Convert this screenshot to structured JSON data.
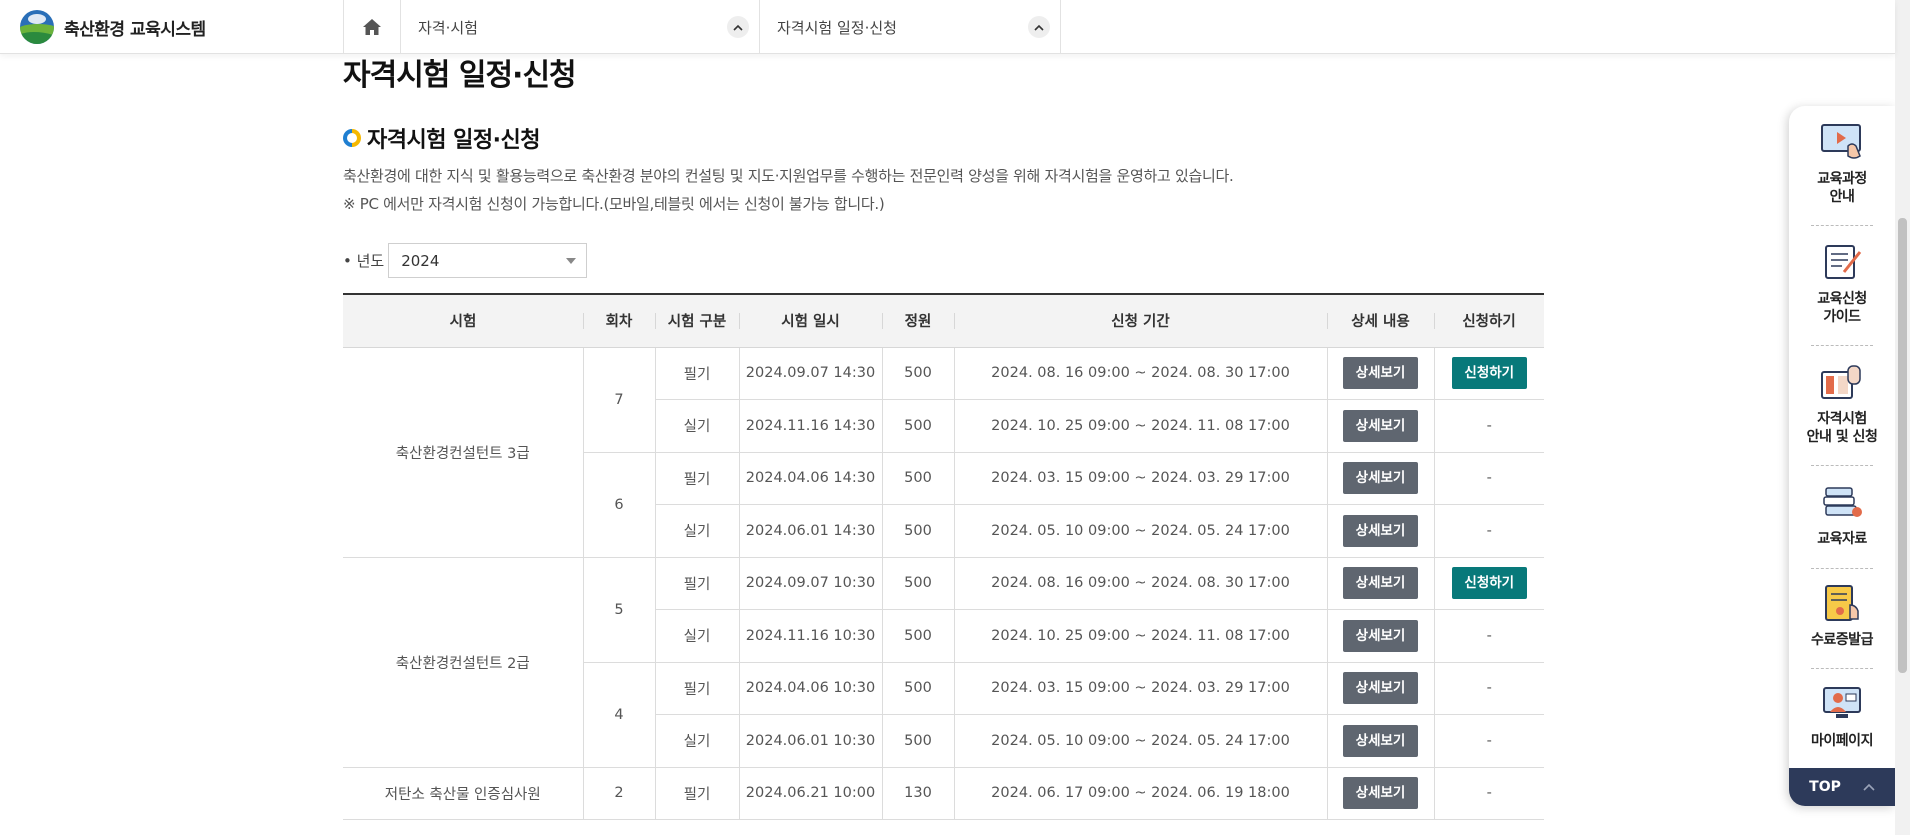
{
  "header": {
    "logo_text": "축산환경 교육시스템",
    "nav": [
      {
        "label": "자격·시험"
      },
      {
        "label": "자격시험 일정·신청"
      }
    ]
  },
  "page": {
    "title": "자격시험 일정·신청",
    "section_title": "자격시험 일정·신청",
    "desc1": "축산환경에 대한 지식 및 활용능력으로 축산환경 분야의 컨설팅 및 지도·지원업무를 수행하는 전문인력 양성을 위해 자격시험을 운영하고 있습니다.",
    "desc2": "※ PC 에서만 자격시험 신청이 가능합니다.(모바일,테블릿 에서는 신청이 불가능 합니다.)"
  },
  "filter": {
    "label": "• 년도",
    "year_value": "2024"
  },
  "table": {
    "headers": [
      "시험",
      "회차",
      "시험 구분",
      "시험 일시",
      "정원",
      "신청 기간",
      "상세 내용",
      "신청하기"
    ],
    "groups": [
      {
        "exam": "축산환경컨설턴트 3급",
        "rounds": [
          {
            "round": "7",
            "rows": [
              {
                "type": "필기",
                "datetime": "2024.09.07 14:30",
                "capacity": "500",
                "period": "2024. 08. 16 09:00 ~ 2024. 08. 30 17:00",
                "detail": "상세보기",
                "apply": "신청하기"
              },
              {
                "type": "실기",
                "datetime": "2024.11.16 14:30",
                "capacity": "500",
                "period": "2024. 10. 25 09:00 ~ 2024. 11. 08 17:00",
                "detail": "상세보기",
                "apply": "-"
              }
            ]
          },
          {
            "round": "6",
            "rows": [
              {
                "type": "필기",
                "datetime": "2024.04.06 14:30",
                "capacity": "500",
                "period": "2024. 03. 15 09:00 ~ 2024. 03. 29 17:00",
                "detail": "상세보기",
                "apply": "-"
              },
              {
                "type": "실기",
                "datetime": "2024.06.01 14:30",
                "capacity": "500",
                "period": "2024. 05. 10 09:00 ~ 2024. 05. 24 17:00",
                "detail": "상세보기",
                "apply": "-"
              }
            ]
          }
        ]
      },
      {
        "exam": "축산환경컨설턴트 2급",
        "rounds": [
          {
            "round": "5",
            "rows": [
              {
                "type": "필기",
                "datetime": "2024.09.07 10:30",
                "capacity": "500",
                "period": "2024. 08. 16 09:00 ~ 2024. 08. 30 17:00",
                "detail": "상세보기",
                "apply": "신청하기"
              },
              {
                "type": "실기",
                "datetime": "2024.11.16 10:30",
                "capacity": "500",
                "period": "2024. 10. 25 09:00 ~ 2024. 11. 08 17:00",
                "detail": "상세보기",
                "apply": "-"
              }
            ]
          },
          {
            "round": "4",
            "rows": [
              {
                "type": "필기",
                "datetime": "2024.04.06 10:30",
                "capacity": "500",
                "period": "2024. 03. 15 09:00 ~ 2024. 03. 29 17:00",
                "detail": "상세보기",
                "apply": "-"
              },
              {
                "type": "실기",
                "datetime": "2024.06.01 10:30",
                "capacity": "500",
                "period": "2024. 05. 10 09:00 ~ 2024. 05. 24 17:00",
                "detail": "상세보기",
                "apply": "-"
              }
            ]
          }
        ]
      },
      {
        "exam": "저탄소 축산물 인증심사원",
        "rounds": [
          {
            "round": "2",
            "rows": [
              {
                "type": "필기",
                "datetime": "2024.06.21 10:00",
                "capacity": "130",
                "period": "2024. 06. 17 09:00 ~ 2024. 06. 19 18:00",
                "detail": "상세보기",
                "apply": "-"
              }
            ]
          }
        ]
      }
    ]
  },
  "quick_menu": {
    "items": [
      {
        "label1": "교육과정",
        "label2": "안내",
        "icon": "course-guide-icon"
      },
      {
        "label1": "교육신청",
        "label2": "가이드",
        "icon": "application-guide-icon"
      },
      {
        "label1": "자격시험",
        "label2": "안내 및 신청",
        "icon": "exam-icon"
      },
      {
        "label1": "교육자료",
        "label2": "",
        "icon": "materials-icon"
      },
      {
        "label1": "수료증발급",
        "label2": "",
        "icon": "certificate-icon"
      },
      {
        "label1": "마이페이지",
        "label2": "",
        "icon": "mypage-icon"
      }
    ],
    "top_label": "TOP"
  },
  "colors": {
    "apply_button": "#08797a",
    "detail_button": "#5f6670",
    "top_button": "#2d3a5a"
  }
}
